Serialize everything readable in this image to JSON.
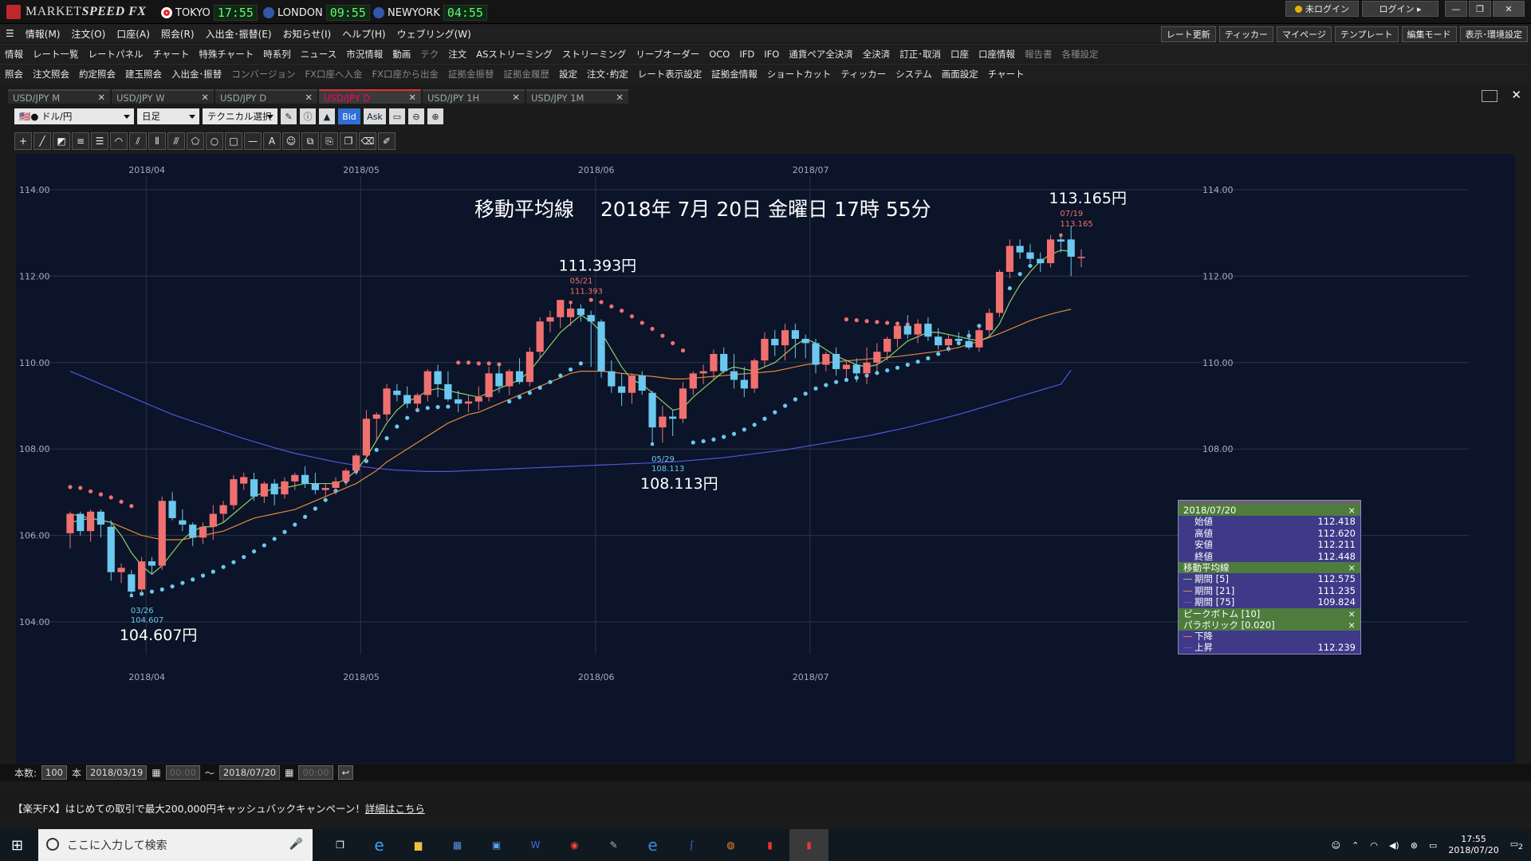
{
  "app": {
    "name_pre": "MARKET",
    "name_b": "SPEED FX",
    "markets": [
      {
        "name": "TOKYO",
        "time": "17:55",
        "flag": "#e22"
      },
      {
        "name": "LONDON",
        "time": "09:55",
        "flag": "#35a"
      },
      {
        "name": "NEWYORK",
        "time": "04:55",
        "flag": "#35a"
      }
    ],
    "login_status": "未ログイン",
    "login_button": "ログイン"
  },
  "menu": [
    "情報(M)",
    "注文(O)",
    "口座(A)",
    "照会(R)",
    "入出金･振替(E)",
    "お知らせ(I)",
    "ヘルプ(H)",
    "ウェブリング(W)"
  ],
  "right_tools": [
    "レート更新",
    "ティッカー",
    "マイページ",
    "テンプレート",
    "編集モード",
    "表示･環境設定"
  ],
  "toolbar1": [
    {
      "t": "情報"
    },
    {
      "t": "レート一覧"
    },
    {
      "t": "レートパネル"
    },
    {
      "t": "チャート"
    },
    {
      "t": "特殊チャート"
    },
    {
      "t": "時系列"
    },
    {
      "t": "ニュース"
    },
    {
      "t": "市況情報"
    },
    {
      "t": "動画"
    },
    {
      "t": "テク",
      "dim": true
    },
    {
      "t": "注文"
    },
    {
      "t": "ASストリーミング"
    },
    {
      "t": "ストリーミング"
    },
    {
      "t": "リーブオーダー"
    },
    {
      "t": "OCO"
    },
    {
      "t": "IFD"
    },
    {
      "t": "IFO"
    },
    {
      "t": "通貨ペア全決済"
    },
    {
      "t": "全決済"
    },
    {
      "t": "訂正･取消"
    },
    {
      "t": "口座"
    },
    {
      "t": "口座情報"
    },
    {
      "t": "報告書",
      "dim": true
    },
    {
      "t": "各種設定",
      "dim": true
    }
  ],
  "toolbar2": [
    {
      "t": "照会"
    },
    {
      "t": "注文照会"
    },
    {
      "t": "約定照会"
    },
    {
      "t": "建玉照会"
    },
    {
      "t": "入出金･振替"
    },
    {
      "t": "コンバージョン",
      "dim": true
    },
    {
      "t": "FX口座へ入金",
      "dim": true
    },
    {
      "t": "FX口座から出金",
      "dim": true
    },
    {
      "t": "証拠金振替",
      "dim": true
    },
    {
      "t": "証拠金履歴",
      "dim": true
    },
    {
      "t": "設定"
    },
    {
      "t": "注文･約定"
    },
    {
      "t": "レート表示設定"
    },
    {
      "t": "証拠金情報"
    },
    {
      "t": "ショートカット"
    },
    {
      "t": "ティッカー"
    },
    {
      "t": "システム"
    },
    {
      "t": "画面設定"
    },
    {
      "t": "チャート"
    }
  ],
  "tabs": [
    {
      "label": "USD/JPY M",
      "active": false
    },
    {
      "label": "USD/JPY W",
      "active": false
    },
    {
      "label": "USD/JPY D",
      "active": false
    },
    {
      "label": "USD/JPY D",
      "active": true
    },
    {
      "label": "USD/JPY 1H",
      "active": false
    },
    {
      "label": "USD/JPY 1M",
      "active": false
    }
  ],
  "controls": {
    "pair": "ドル/円",
    "period": "日足",
    "technical": "テクニカル選択",
    "bid": "Bid",
    "ask": "Ask"
  },
  "chart_data": {
    "type": "candlestick",
    "title": "移動平均線　 2018年 7月 20日 金曜日 17時 55分",
    "ylim": [
      103.6,
      115.0
    ],
    "yticks": [
      "104.00",
      "106.00",
      "108.00",
      "110.00",
      "112.00",
      "114.00"
    ],
    "month_labels": [
      "2018/04",
      "2018/05",
      "2018/06",
      "2018/07"
    ],
    "candles": [
      [
        106.05,
        106.55,
        105.7,
        106.5
      ],
      [
        106.5,
        106.55,
        106.0,
        106.1
      ],
      [
        106.1,
        106.6,
        105.85,
        106.55
      ],
      [
        106.55,
        106.6,
        105.95,
        106.25
      ],
      [
        106.2,
        106.35,
        104.95,
        105.15
      ],
      [
        105.15,
        105.35,
        104.9,
        105.25
      ],
      [
        105.1,
        105.2,
        104.607,
        104.7
      ],
      [
        104.75,
        105.5,
        104.65,
        105.4
      ],
      [
        105.4,
        105.5,
        105.1,
        105.3
      ],
      [
        105.3,
        106.9,
        105.2,
        106.8
      ],
      [
        106.8,
        107.0,
        106.35,
        106.4
      ],
      [
        106.35,
        106.6,
        106.1,
        106.25
      ],
      [
        106.25,
        106.3,
        105.75,
        105.95
      ],
      [
        105.95,
        106.3,
        105.8,
        106.2
      ],
      [
        106.2,
        106.7,
        105.9,
        106.5
      ],
      [
        106.5,
        106.8,
        106.3,
        106.7
      ],
      [
        106.7,
        107.4,
        106.6,
        107.3
      ],
      [
        107.2,
        107.45,
        107.05,
        107.35
      ],
      [
        107.3,
        107.45,
        106.8,
        106.9
      ],
      [
        106.9,
        107.25,
        106.75,
        107.2
      ],
      [
        107.2,
        107.3,
        106.7,
        106.95
      ],
      [
        106.95,
        107.35,
        106.85,
        107.25
      ],
      [
        107.25,
        107.45,
        107.05,
        107.4
      ],
      [
        107.4,
        107.6,
        107.1,
        107.2
      ],
      [
        107.2,
        107.45,
        106.95,
        107.05
      ],
      [
        107.05,
        107.2,
        106.9,
        107.1
      ],
      [
        107.1,
        107.35,
        106.95,
        107.25
      ],
      [
        107.25,
        107.55,
        107.15,
        107.5
      ],
      [
        107.5,
        107.9,
        107.4,
        107.85
      ],
      [
        107.85,
        108.9,
        107.7,
        108.7
      ],
      [
        108.7,
        108.85,
        108.2,
        108.8
      ],
      [
        108.8,
        109.5,
        108.65,
        109.4
      ],
      [
        109.35,
        109.5,
        109.1,
        109.25
      ],
      [
        109.25,
        109.45,
        108.95,
        109.05
      ],
      [
        109.05,
        109.3,
        108.85,
        109.25
      ],
      [
        109.25,
        109.85,
        109.1,
        109.8
      ],
      [
        109.8,
        109.95,
        109.2,
        109.5
      ],
      [
        109.5,
        109.8,
        109.1,
        109.15
      ],
      [
        109.15,
        109.35,
        108.85,
        109.05
      ],
      [
        109.05,
        109.25,
        108.85,
        109.1
      ],
      [
        109.1,
        109.45,
        108.9,
        109.2
      ],
      [
        109.2,
        109.9,
        109.1,
        109.75
      ],
      [
        109.75,
        109.95,
        109.3,
        109.45
      ],
      [
        109.45,
        109.85,
        109.25,
        109.8
      ],
      [
        109.8,
        110.1,
        109.5,
        109.55
      ],
      [
        109.55,
        110.35,
        109.45,
        110.25
      ],
      [
        110.25,
        111.05,
        110.1,
        110.95
      ],
      [
        110.95,
        111.2,
        110.7,
        111.05
      ],
      [
        111.05,
        111.45,
        110.8,
        111.45
      ],
      [
        111.05,
        111.393,
        110.85,
        111.25
      ],
      [
        111.25,
        111.35,
        110.95,
        111.1
      ],
      [
        111.1,
        111.2,
        109.9,
        110.95
      ],
      [
        110.95,
        111.0,
        109.65,
        109.8
      ],
      [
        109.8,
        110.05,
        109.3,
        109.45
      ],
      [
        109.45,
        109.75,
        109.0,
        109.3
      ],
      [
        109.3,
        109.75,
        109.05,
        109.7
      ],
      [
        109.7,
        109.8,
        109.25,
        109.35
      ],
      [
        109.3,
        109.35,
        108.113,
        108.5
      ],
      [
        108.5,
        109.0,
        108.15,
        108.75
      ],
      [
        108.75,
        108.9,
        108.3,
        108.7
      ],
      [
        108.7,
        109.55,
        108.6,
        109.4
      ],
      [
        109.4,
        109.8,
        109.25,
        109.75
      ],
      [
        109.75,
        109.95,
        109.5,
        109.8
      ],
      [
        109.8,
        110.3,
        109.6,
        110.2
      ],
      [
        110.2,
        110.35,
        109.75,
        109.8
      ],
      [
        109.8,
        110.2,
        109.4,
        109.6
      ],
      [
        109.6,
        109.9,
        109.2,
        109.4
      ],
      [
        109.4,
        110.1,
        109.3,
        110.05
      ],
      [
        110.05,
        110.7,
        109.9,
        110.55
      ],
      [
        110.55,
        110.75,
        110.15,
        110.4
      ],
      [
        110.4,
        110.9,
        110.05,
        110.75
      ],
      [
        110.75,
        110.9,
        110.1,
        110.55
      ],
      [
        110.55,
        110.65,
        110.1,
        110.45
      ],
      [
        110.45,
        110.55,
        109.75,
        109.95
      ],
      [
        109.95,
        110.25,
        109.8,
        110.2
      ],
      [
        110.2,
        110.35,
        109.7,
        109.85
      ],
      [
        109.85,
        110.05,
        109.65,
        109.95
      ],
      [
        109.95,
        110.1,
        109.55,
        109.75
      ],
      [
        109.75,
        110.35,
        109.5,
        110.0
      ],
      [
        110.0,
        110.45,
        109.8,
        110.25
      ],
      [
        110.25,
        110.6,
        110.05,
        110.55
      ],
      [
        110.55,
        110.95,
        110.35,
        110.85
      ],
      [
        110.85,
        111.1,
        110.55,
        110.65
      ],
      [
        110.65,
        111.0,
        110.45,
        110.9
      ],
      [
        110.9,
        111.05,
        110.5,
        110.6
      ],
      [
        110.6,
        110.8,
        110.3,
        110.4
      ],
      [
        110.4,
        110.65,
        110.25,
        110.55
      ],
      [
        110.55,
        110.7,
        110.4,
        110.5
      ],
      [
        110.5,
        110.75,
        110.3,
        110.35
      ],
      [
        110.35,
        110.85,
        110.25,
        110.75
      ],
      [
        110.75,
        111.25,
        110.6,
        111.15
      ],
      [
        111.15,
        112.15,
        111.05,
        112.1
      ],
      [
        112.1,
        112.85,
        111.95,
        112.7
      ],
      [
        112.7,
        112.85,
        112.4,
        112.55
      ],
      [
        112.55,
        112.75,
        112.3,
        112.4
      ],
      [
        112.4,
        112.55,
        112.1,
        112.3
      ],
      [
        112.3,
        112.95,
        112.2,
        112.85
      ],
      [
        112.85,
        112.95,
        112.55,
        112.8
      ],
      [
        112.85,
        113.165,
        112.0,
        112.45
      ],
      [
        112.418,
        112.62,
        112.211,
        112.448
      ]
    ],
    "psar_down": [
      107.12,
      107.1,
      107.02,
      106.95,
      106.88,
      106.78,
      106.68,
      null,
      null,
      null,
      null,
      null,
      null,
      null,
      null,
      null,
      null,
      null,
      null,
      null,
      null,
      null,
      null,
      null,
      null,
      null,
      null,
      null,
      null,
      null,
      null,
      null,
      null,
      null,
      null,
      null,
      null,
      null,
      110.0,
      110.0,
      109.98,
      109.98,
      109.96,
      null,
      null,
      null,
      null,
      null,
      null,
      null,
      null,
      111.45,
      111.4,
      111.3,
      111.2,
      111.07,
      110.92,
      110.78,
      110.62,
      110.45,
      110.28,
      null,
      null,
      null,
      null,
      null,
      null,
      null,
      null,
      null,
      null,
      null,
      null,
      null,
      null,
      null,
      111.0,
      110.98,
      110.96,
      110.94,
      110.92,
      110.9,
      110.88,
      110.86,
      null
    ],
    "psar_up": [
      null,
      null,
      null,
      null,
      null,
      null,
      null,
      104.65,
      104.7,
      104.75,
      104.82,
      104.9,
      104.98,
      105.07,
      105.16,
      105.27,
      105.38,
      105.5,
      105.63,
      105.77,
      105.92,
      106.08,
      106.25,
      106.43,
      106.62,
      106.82,
      107.03,
      107.25,
      107.48,
      107.72,
      107.98,
      108.25,
      108.52,
      108.72,
      108.9,
      108.95,
      108.97,
      108.98,
      null,
      null,
      null,
      null,
      null,
      109.1,
      109.2,
      109.3,
      109.42,
      109.55,
      109.7,
      109.84,
      109.98,
      null,
      null,
      null,
      null,
      null,
      null,
      null,
      null,
      null,
      null,
      108.15,
      108.18,
      108.22,
      108.28,
      108.35,
      108.45,
      108.56,
      108.7,
      108.85,
      109.0,
      109.15,
      109.28,
      109.4,
      109.48,
      109.55,
      109.6,
      109.65,
      109.7,
      109.76,
      109.82,
      109.88,
      109.95,
      110.02,
      110.1,
      110.2,
      110.32,
      110.45,
      110.62,
      110.85,
      111.1,
      111.4,
      111.72,
      112.05,
      112.239
    ],
    "ma5": [
      106.3,
      106.35,
      106.4,
      106.35,
      106.3,
      106.0,
      105.6,
      105.3,
      105.1,
      105.3,
      105.6,
      105.9,
      106.1,
      106.2,
      106.2,
      106.3,
      106.5,
      106.7,
      106.9,
      107.0,
      107.1,
      107.1,
      107.15,
      107.2,
      107.2,
      107.2,
      107.2,
      107.3,
      107.5,
      107.8,
      108.2,
      108.6,
      108.9,
      109.1,
      109.2,
      109.35,
      109.4,
      109.35,
      109.3,
      109.25,
      109.2,
      109.3,
      109.4,
      109.5,
      109.6,
      109.8,
      110.1,
      110.4,
      110.7,
      110.9,
      111.1,
      110.95,
      110.7,
      110.3,
      109.9,
      109.6,
      109.5,
      109.3,
      109.1,
      108.9,
      108.95,
      109.2,
      109.4,
      109.6,
      109.8,
      109.9,
      109.85,
      109.8,
      109.9,
      110.0,
      110.2,
      110.4,
      110.55,
      110.45,
      110.3,
      110.15,
      110.05,
      109.95,
      109.9,
      109.95,
      110.1,
      110.3,
      110.5,
      110.6,
      110.7,
      110.7,
      110.65,
      110.6,
      110.55,
      110.5,
      110.6,
      110.9,
      111.4,
      111.8,
      112.1,
      112.35,
      112.5,
      112.6,
      112.575
    ],
    "ma21": [
      106.5,
      106.45,
      106.4,
      106.35,
      106.3,
      106.2,
      106.1,
      106.0,
      105.95,
      105.9,
      105.9,
      105.9,
      105.95,
      106.0,
      106.05,
      106.1,
      106.2,
      106.3,
      106.4,
      106.45,
      106.5,
      106.55,
      106.6,
      106.7,
      106.8,
      106.9,
      107.0,
      107.1,
      107.2,
      107.35,
      107.5,
      107.7,
      107.85,
      108.0,
      108.15,
      108.3,
      108.45,
      108.6,
      108.7,
      108.8,
      108.85,
      108.95,
      109.05,
      109.15,
      109.25,
      109.35,
      109.45,
      109.55,
      109.65,
      109.75,
      109.8,
      109.8,
      109.8,
      109.78,
      109.75,
      109.73,
      109.7,
      109.68,
      109.65,
      109.62,
      109.62,
      109.64,
      109.66,
      109.68,
      109.7,
      109.72,
      109.74,
      109.76,
      109.78,
      109.8,
      109.85,
      109.9,
      109.95,
      109.98,
      110.0,
      110.02,
      110.04,
      110.06,
      110.08,
      110.1,
      110.12,
      110.14,
      110.17,
      110.2,
      110.23,
      110.26,
      110.3,
      110.35,
      110.42,
      110.5,
      110.58,
      110.67,
      110.77,
      110.87,
      110.97,
      111.05,
      111.12,
      111.18,
      111.235
    ],
    "ma75": [
      109.8,
      109.7,
      109.6,
      109.5,
      109.4,
      109.3,
      109.2,
      109.1,
      109.0,
      108.9,
      108.8,
      108.72,
      108.64,
      108.56,
      108.48,
      108.4,
      108.32,
      108.24,
      108.17,
      108.1,
      108.03,
      107.96,
      107.9,
      107.85,
      107.8,
      107.75,
      107.7,
      107.66,
      107.62,
      107.58,
      107.55,
      107.53,
      107.51,
      107.5,
      107.49,
      107.48,
      107.48,
      107.48,
      107.49,
      107.5,
      107.51,
      107.52,
      107.53,
      107.54,
      107.55,
      107.56,
      107.57,
      107.58,
      107.59,
      107.6,
      107.61,
      107.62,
      107.63,
      107.64,
      107.65,
      107.66,
      107.67,
      107.68,
      107.69,
      107.7,
      107.72,
      107.74,
      107.76,
      107.78,
      107.8,
      107.83,
      107.86,
      107.89,
      107.92,
      107.95,
      107.98,
      108.02,
      108.06,
      108.1,
      108.14,
      108.18,
      108.22,
      108.26,
      108.3,
      108.35,
      108.4,
      108.45,
      108.5,
      108.56,
      108.62,
      108.68,
      108.74,
      108.8,
      108.87,
      108.94,
      109.01,
      109.08,
      109.15,
      109.22,
      109.29,
      109.36,
      109.43,
      109.5,
      109.824
    ],
    "annotations": [
      {
        "price": "104.607円",
        "date": "03/26",
        "value": "104.607",
        "idx": 6,
        "kind": "low"
      },
      {
        "price": "111.393円",
        "date": "05/21",
        "value": "111.393",
        "idx": 49,
        "kind": "high"
      },
      {
        "price": "108.113円",
        "date": "05/29",
        "value": "108.113",
        "idx": 57,
        "kind": "low"
      },
      {
        "price": "113.165円",
        "date": "07/19",
        "value": "113.165",
        "idx": 97,
        "kind": "high"
      }
    ],
    "colors": {
      "up": "#f07070",
      "down": "#6cc8ee",
      "ma5": "#8fcf6a",
      "ma21": "#e08a3c",
      "ma75": "#5555d8",
      "psar": "#6cc8ee",
      "psar_down": "#f07070"
    }
  },
  "infobox": {
    "date": "2018/07/20",
    "ohlc": [
      {
        "label": "始値",
        "value": "112.418"
      },
      {
        "label": "高値",
        "value": "112.620"
      },
      {
        "label": "安値",
        "value": "112.211"
      },
      {
        "label": "終値",
        "value": "112.448"
      }
    ],
    "ma_title": "移動平均線",
    "ma": [
      {
        "label": "期間 [5]",
        "value": "112.575",
        "color": "#8fcf6a"
      },
      {
        "label": "期間 [21]",
        "value": "111.235",
        "color": "#e08a3c"
      },
      {
        "label": "期間 [75]",
        "value": "109.824",
        "color": "#5555d8"
      }
    ],
    "peak_title": "ピークボトム [10]",
    "psar_title": "パラボリック [0.020]",
    "psar": [
      {
        "label": "下降",
        "value": "",
        "color": "#f07070"
      },
      {
        "label": "上昇",
        "value": "112.239",
        "color": "#5555d8"
      }
    ]
  },
  "footer": {
    "count_label": "本数:",
    "count": "100",
    "unit": "本",
    "from": "2018/03/19",
    "from_time": "00:00",
    "tilde": "～",
    "to": "2018/07/20",
    "to_time": "00:00"
  },
  "ad": {
    "text": "【楽天FX】はじめての取引で最大200,000円キャッシュバックキャンペーン！",
    "link": "詳細はこちら"
  },
  "taskbar": {
    "search": "ここに入力して検索",
    "time": "17:55",
    "date": "2018/07/20",
    "notif": "2"
  }
}
